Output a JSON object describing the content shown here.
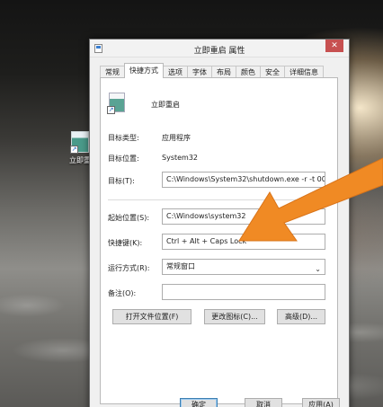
{
  "desktop": {
    "icon_label": "立即重"
  },
  "dialog": {
    "title": "立即重启 属性",
    "close_glyph": "✕",
    "tabs": [
      "常规",
      "快捷方式",
      "选项",
      "字体",
      "布局",
      "颜色",
      "安全",
      "详细信息"
    ],
    "active_tab": 1,
    "shortcut_name": "立即重启",
    "fields": {
      "target_type_label": "目标类型:",
      "target_type_value": "应用程序",
      "target_location_label": "目标位置:",
      "target_location_value": "System32",
      "target_label": "目标(T):",
      "target_value": "C:\\Windows\\System32\\shutdown.exe -r -t 00",
      "start_in_label": "起始位置(S):",
      "start_in_value": "C:\\Windows\\system32",
      "hotkey_label": "快捷键(K):",
      "hotkey_value": "Ctrl + Alt + Caps Lock",
      "run_label": "运行方式(R):",
      "run_value": "常规窗口",
      "comment_label": "备注(O):",
      "comment_value": ""
    },
    "buttons": {
      "open_location": "打开文件位置(F)",
      "change_icon": "更改图标(C)...",
      "advanced": "高级(D)..."
    },
    "footer": {
      "ok": "确定",
      "cancel": "取消",
      "apply": "应用(A)"
    }
  },
  "colors": {
    "arrow": "#f08a24",
    "close_button": "#c75050"
  }
}
